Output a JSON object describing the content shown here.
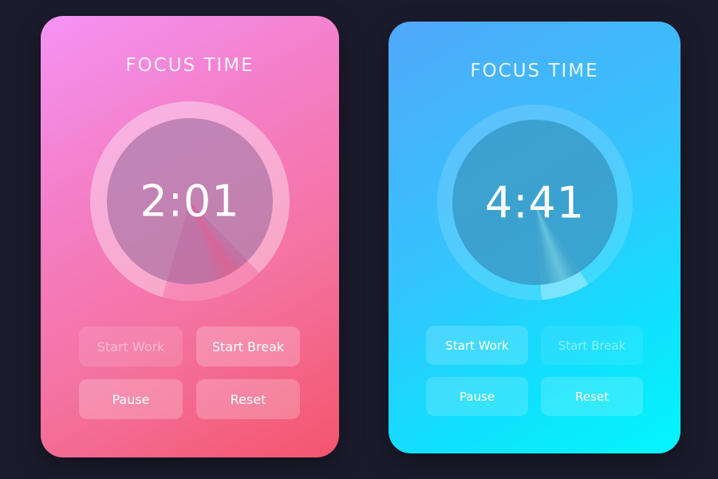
{
  "colors": {
    "background": "#1b1b2c",
    "pink_gradient": [
      "#f593f5",
      "#f47ec6",
      "#f4729f",
      "#f4556c"
    ],
    "blue_gradient": [
      "#51a8fb",
      "#35c3fd",
      "#10e0fd",
      "#03f6fe"
    ],
    "text": "#ffffff"
  },
  "timers": [
    {
      "theme": "pink",
      "title": "FOCUS TIME",
      "time": "2:01",
      "buttons": {
        "start_work": "Start Work",
        "start_break": "Start Break",
        "pause": "Pause",
        "reset": "Reset"
      },
      "start_work_disabled": true,
      "start_break_disabled": false
    },
    {
      "theme": "blue",
      "title": "FOCUS TIME",
      "time": "4:41",
      "buttons": {
        "start_work": "Start Work",
        "start_break": "Start Break",
        "pause": "Pause",
        "reset": "Reset"
      },
      "start_work_disabled": false,
      "start_break_disabled": true
    }
  ]
}
